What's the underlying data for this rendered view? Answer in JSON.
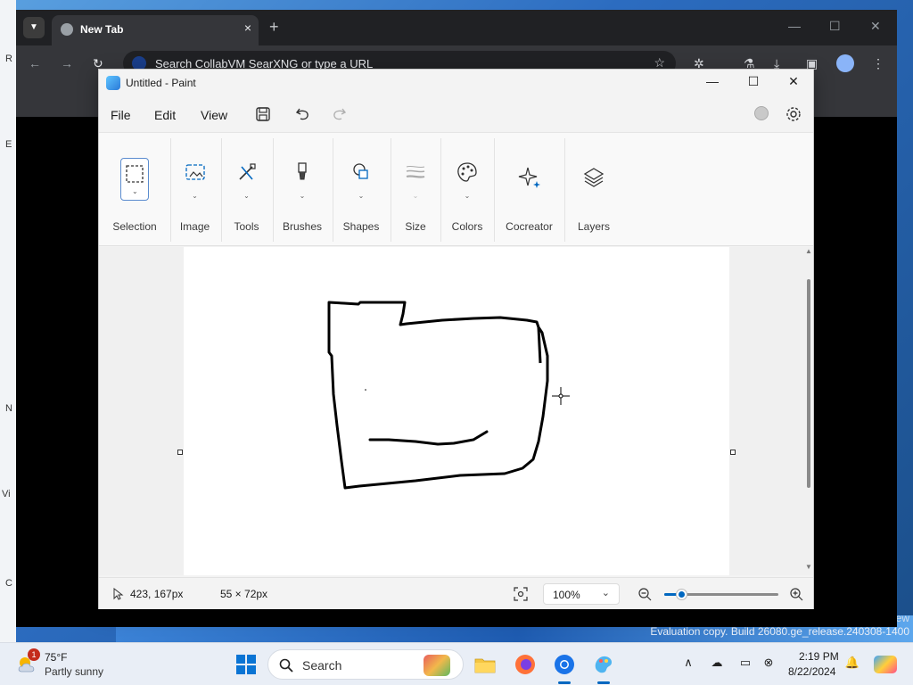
{
  "browser": {
    "tab_title": "New Tab",
    "tab_close": "×",
    "new_tab": "+",
    "omnibox_placeholder": "Search CollabVM SearXNG or type a URL",
    "minimize": "—",
    "maximize": "☐",
    "close": "✕",
    "back": "←",
    "forward": "→",
    "reload": "↻"
  },
  "paint": {
    "window_title": "Untitled - Paint",
    "minimize": "—",
    "maximize": "☐",
    "close": "✕",
    "menu": {
      "file": "File",
      "edit": "Edit",
      "view": "View"
    },
    "ribbon": [
      {
        "label": "Selection",
        "icon": "selection-rectangle-icon"
      },
      {
        "label": "Image",
        "icon": "image-icon"
      },
      {
        "label": "Tools",
        "icon": "tools-icon"
      },
      {
        "label": "Brushes",
        "icon": "brush-icon"
      },
      {
        "label": "Shapes",
        "icon": "shapes-icon"
      },
      {
        "label": "Size",
        "icon": "size-icon"
      },
      {
        "label": "Colors",
        "icon": "palette-icon"
      },
      {
        "label": "Cocreator",
        "icon": "sparkle-icon"
      },
      {
        "label": "Layers",
        "icon": "layers-icon"
      }
    ],
    "status": {
      "cursor_position": "423, 167px",
      "selection_size": "55 × 72px",
      "zoom": "100%",
      "zoom_level": 0.15
    }
  },
  "desktop": {
    "watermark": "Evaluation copy. Build 26080.ge_release.240308-1400",
    "watermark_fragment": "ew",
    "edge_letters": [
      "R",
      "E",
      "N",
      "Vi",
      "C"
    ]
  },
  "taskbar": {
    "weather_temp": "75°F",
    "weather_desc": "Partly sunny",
    "weather_badge": "1",
    "search_label": "Search",
    "time": "2:19 PM",
    "date": "8/22/2024",
    "accent_color": "#0067c0"
  }
}
